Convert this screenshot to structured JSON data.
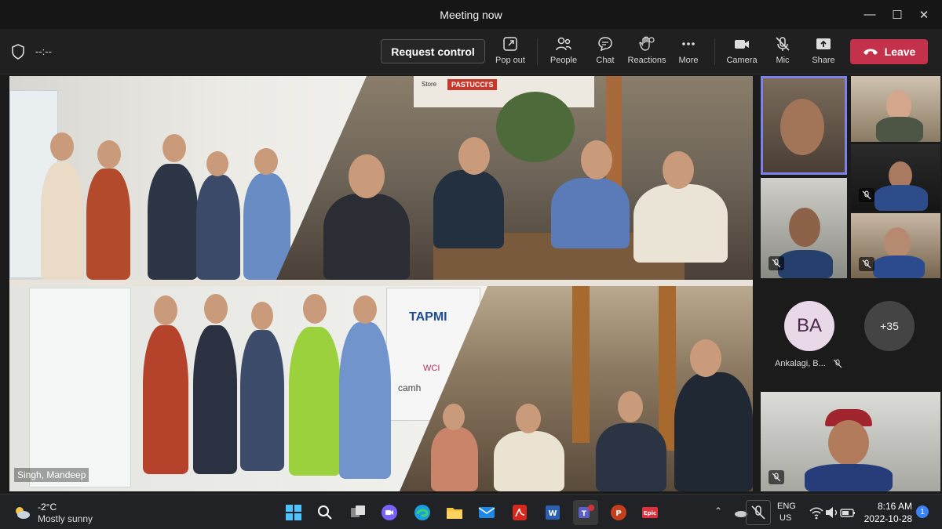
{
  "window": {
    "title": "Meeting now"
  },
  "toolbar": {
    "timer": "--:--",
    "request_control": "Request control",
    "pop_out": "Pop out",
    "people": "People",
    "chat": "Chat",
    "reactions": "Reactions",
    "more": "More",
    "camera": "Camera",
    "mic": "Mic",
    "share": "Share",
    "leave": "Leave"
  },
  "stage": {
    "presenter_name": "Singh, Mandeep",
    "signs": {
      "tapmi": "TAPMI",
      "pastuccis": "PASTUCCI'S",
      "store": "Store",
      "cambh": "camh",
      "wcm": "WCI"
    }
  },
  "roster": {
    "avatar_initials": "BA",
    "overflow_count": "+35",
    "participant_name": "Ankalagi, B..."
  },
  "taskbar": {
    "temperature": "-2°C",
    "weather": "Mostly sunny",
    "lang": "ENG",
    "region": "US",
    "time": "8:16 AM",
    "date": "2022-10-28",
    "notifications": "1"
  },
  "colors": {
    "leave": "#c4314b",
    "active_speaker_border": "#7b83eb",
    "toolbar": "#202020"
  }
}
